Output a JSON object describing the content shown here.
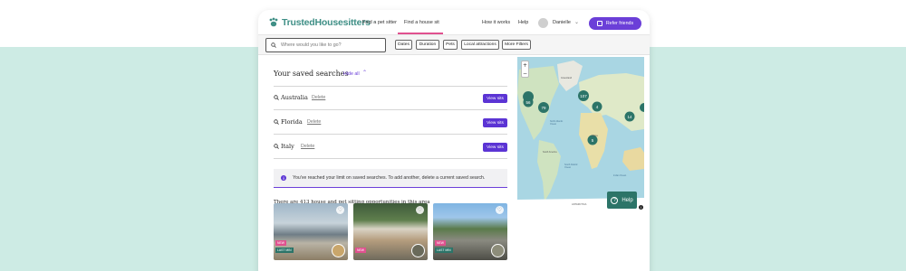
{
  "brand": {
    "name": "TrustedHousesitters",
    "tm": "™"
  },
  "nav": {
    "find_sitter": "Find a pet sitter",
    "find_house_sit": "Find a house sit",
    "how_it_works": "How it works",
    "help": "Help",
    "user_name": "Danielle",
    "refer": "Refer friends"
  },
  "filters": {
    "search_placeholder": "Where would you like to go?",
    "buttons": [
      "Dates",
      "Duration",
      "Pets",
      "Local attractions",
      "More Filters"
    ]
  },
  "saved": {
    "title": "Your saved searches",
    "hide_all": "Hide all",
    "searches": [
      {
        "name": "Australia",
        "delete": "Delete",
        "view": "View sits"
      },
      {
        "name": "Florida",
        "delete": "Delete",
        "view": "View sits"
      },
      {
        "name": "Italy",
        "delete": "Delete",
        "view": "View sits"
      }
    ],
    "limit_notice": "You've reached your limit on saved searches. To add another, delete a current saved search."
  },
  "results": {
    "count_text": "There are 413 house and pet sitting opportunities in this area",
    "cards": [
      {
        "badges": [
          "NEW",
          "LAST MIN"
        ]
      },
      {
        "badges": [
          "NEW"
        ]
      },
      {
        "badges": [
          "NEW",
          "LAST MIN"
        ]
      }
    ]
  },
  "map": {
    "zoom_in": "+",
    "zoom_out": "−",
    "clusters": [
      "56",
      "79",
      "107",
      "4",
      "14",
      "5"
    ],
    "labels": {
      "greenland": "Greenland",
      "north_atlantic": "North Atlantic Ocean",
      "south_atlantic": "South Atlantic Ocean",
      "indian": "Indian Ocean",
      "antarctica": "ANTARCTICA",
      "africa": "Africa",
      "south_america": "South America"
    },
    "help": "Help"
  },
  "colors": {
    "brand_teal": "#3f8f86",
    "accent_purple": "#6b3fd8",
    "bg_mint": "#cdebe4",
    "pin_teal": "#2c7468"
  }
}
